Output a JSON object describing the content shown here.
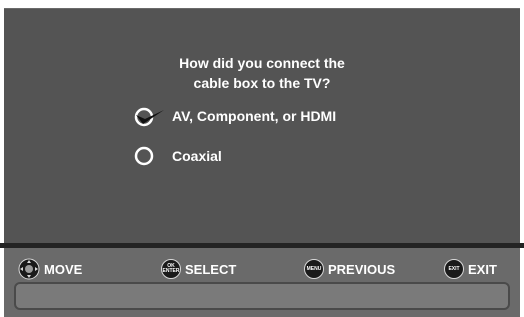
{
  "dialog": {
    "question_line1": "How did you connect the",
    "question_line2": "cable box to the TV?",
    "options": [
      {
        "label": "AV, Component, or HDMI",
        "selected": true
      },
      {
        "label": "Coaxial",
        "selected": false
      }
    ]
  },
  "footer": {
    "move_label": "MOVE",
    "select_label": "SELECT",
    "select_key_line1": "OK",
    "select_key_line2": "ENTER",
    "previous_label": "PREVIOUS",
    "previous_key": "MENU",
    "exit_label": "EXIT",
    "exit_key": "EXIT"
  },
  "icons": {
    "move": "dpad-icon",
    "select": "ok-enter-button-icon",
    "previous": "menu-button-icon",
    "exit": "exit-button-icon",
    "selected_option": "checkmark-icon",
    "radio": "radio-icon"
  },
  "colors": {
    "dialog_bg": "#545454",
    "bar_bg": "#6a6a6a",
    "text": "#ffffff"
  }
}
